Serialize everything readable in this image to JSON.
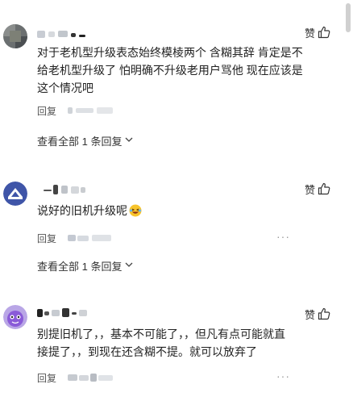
{
  "comments": [
    {
      "username": "",
      "like_label": "赞",
      "content_lines": [
        "对于老机型升级表态始终模棱两个 含糊其辞 肯定是不",
        "给老机型升级了 怕明确不升级老用户骂他 现在应该是",
        "这个情况吧"
      ],
      "reply_label": "回复",
      "view_all_label": "查看全部 1 条回复"
    },
    {
      "username": "",
      "like_label": "赞",
      "content_lines": [
        "说好的旧机升级呢"
      ],
      "reply_label": "回复",
      "view_all_label": "查看全部 1 条回复"
    },
    {
      "username": "",
      "like_label": "赞",
      "content_lines": [
        "别提旧机了，，基本不可能了，，但凡有点可能就直",
        "接提了，，到现在还含糊不提。就可以放弃了"
      ],
      "reply_label": "回复"
    }
  ],
  "more_label": "···",
  "icons": {
    "like": "thumbs-up-icon",
    "chevron": "chevron-down-icon",
    "more": "more-dots-icon",
    "emoji": "laughing-emoji-icon"
  },
  "colors": {
    "text": "#222222",
    "meta": "#555555",
    "divider": "#f0f0f0"
  }
}
